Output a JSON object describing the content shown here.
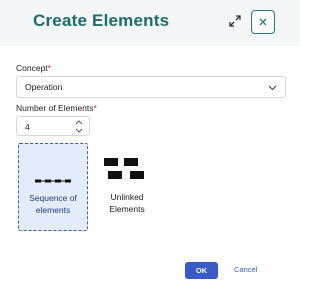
{
  "dialog": {
    "title": "Create Elements",
    "icons": {
      "expand": "expand-icon",
      "close": "close-icon"
    }
  },
  "concept": {
    "label": "Concept",
    "required_mark": "*",
    "value": "Operation",
    "icon": "chevron-down-icon"
  },
  "number_of_elements": {
    "label": "Number of Elements",
    "required_mark": "*",
    "value": "4",
    "icon": "spinner-icon"
  },
  "options": [
    {
      "label_line1": "Sequence of",
      "label_line2": "elements",
      "selected": true,
      "icon": "sequence-icon"
    },
    {
      "label_line1": "Unlinked",
      "label_line2": "Elements",
      "selected": false,
      "icon": "unlinked-elements-icon"
    }
  ],
  "actions": {
    "ok_label": "OK",
    "cancel_label": "Cancel"
  },
  "colors": {
    "accent": "#1f6b69",
    "primary": "#3a5bc7",
    "required": "#d62828",
    "selected_bg": "#e3ecfb"
  }
}
